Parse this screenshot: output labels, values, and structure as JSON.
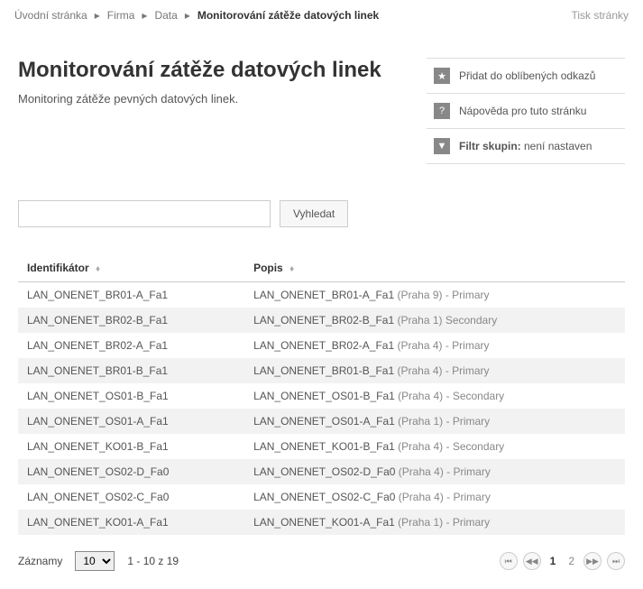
{
  "breadcrumb": {
    "items": [
      "Úvodní stránka",
      "Firma",
      "Data"
    ],
    "current": "Monitorování zátěže datových linek",
    "print": "Tisk stránky"
  },
  "header": {
    "title": "Monitorování zátěže datových linek",
    "subtitle": "Monitoring zátěže pevných datových linek."
  },
  "side": {
    "favorite": "Přidat do oblíbených odkazů",
    "help": "Nápověda pro tuto stránku",
    "filter_label": "Filtr skupin:",
    "filter_value": " není nastaven"
  },
  "search": {
    "button": "Vyhledat"
  },
  "table": {
    "col_id": "Identifikátor",
    "col_desc": "Popis",
    "rows": [
      {
        "id": "LAN_ONENET_BR01-A_Fa1",
        "d1": "LAN_ONENET_BR01-A_Fa1",
        "d2": " (Praha 9) - Primary"
      },
      {
        "id": "LAN_ONENET_BR02-B_Fa1",
        "d1": "LAN_ONENET_BR02-B_Fa1",
        "d2": " (Praha 1) Secondary"
      },
      {
        "id": "LAN_ONENET_BR02-A_Fa1",
        "d1": "LAN_ONENET_BR02-A_Fa1",
        "d2": " (Praha 4) - Primary"
      },
      {
        "id": "LAN_ONENET_BR01-B_Fa1",
        "d1": "LAN_ONENET_BR01-B_Fa1",
        "d2": " (Praha 4) - Primary"
      },
      {
        "id": "LAN_ONENET_OS01-B_Fa1",
        "d1": "LAN_ONENET_OS01-B_Fa1",
        "d2": " (Praha 4) - Secondary"
      },
      {
        "id": "LAN_ONENET_OS01-A_Fa1",
        "d1": "LAN_ONENET_OS01-A_Fa1",
        "d2": " (Praha 1) - Primary"
      },
      {
        "id": "LAN_ONENET_KO01-B_Fa1",
        "d1": "LAN_ONENET_KO01-B_Fa1",
        "d2": " (Praha 4) - Secondary"
      },
      {
        "id": "LAN_ONENET_OS02-D_Fa0",
        "d1": "LAN_ONENET_OS02-D_Fa0",
        "d2": " (Praha 4) - Primary"
      },
      {
        "id": "LAN_ONENET_OS02-C_Fa0",
        "d1": "LAN_ONENET_OS02-C_Fa0",
        "d2": " (Praha 4) - Primary"
      },
      {
        "id": "LAN_ONENET_KO01-A_Fa1",
        "d1": "LAN_ONENET_KO01-A_Fa1",
        "d2": " (Praha 1) - Primary"
      }
    ]
  },
  "footer": {
    "records": "Záznamy",
    "per_page": "10",
    "range": "1 - 10 z 19",
    "pages": {
      "p1": "1",
      "p2": "2"
    }
  }
}
